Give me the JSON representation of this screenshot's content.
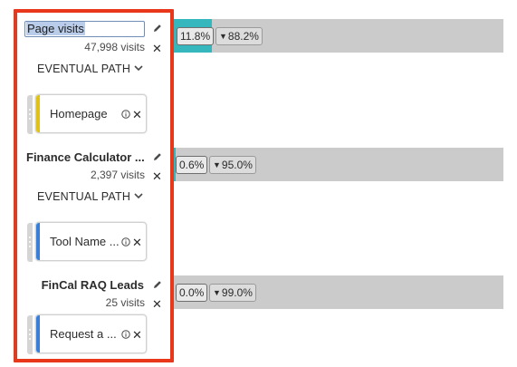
{
  "steps": [
    {
      "title": "Page visits",
      "count": "47,998 visits",
      "path_label": "EVENTUAL PATH",
      "card_label": "Homepage",
      "card_color": "#e0c217",
      "bar": {
        "conversion": "11.8%",
        "dropoff": "88.2%",
        "fill_color": "#35b7bd",
        "fill_fraction": 0.118
      }
    },
    {
      "title": "Finance Calculator ...",
      "count": "2,397 visits",
      "path_label": "EVENTUAL PATH",
      "card_label": "Tool Name ...",
      "card_color": "#3a7fd5",
      "bar": {
        "conversion": "0.6%",
        "dropoff": "95.0%",
        "fill_color": "#35b7bd",
        "fill_fraction": 0.006
      }
    },
    {
      "title": "FinCal RAQ Leads",
      "count": "25 visits",
      "card_label": "Request a ...",
      "card_color": "#3a7fd5",
      "bar": {
        "conversion": "0.0%",
        "dropoff": "99.0%",
        "fill_color": "#35b7bd",
        "fill_fraction": 0.0
      }
    }
  ],
  "icons": {
    "edit": "pencil-icon",
    "remove": "close-icon",
    "expand": "chevron-down-icon",
    "info": "info-icon",
    "drag": "drag-handle-icon",
    "dropoff": "triangle-down-icon"
  },
  "colors": {
    "highlight": "#e8371b",
    "bar_background": "#cbcbcb"
  },
  "glyphs": {
    "close": "✕",
    "dropoff": "▼"
  }
}
